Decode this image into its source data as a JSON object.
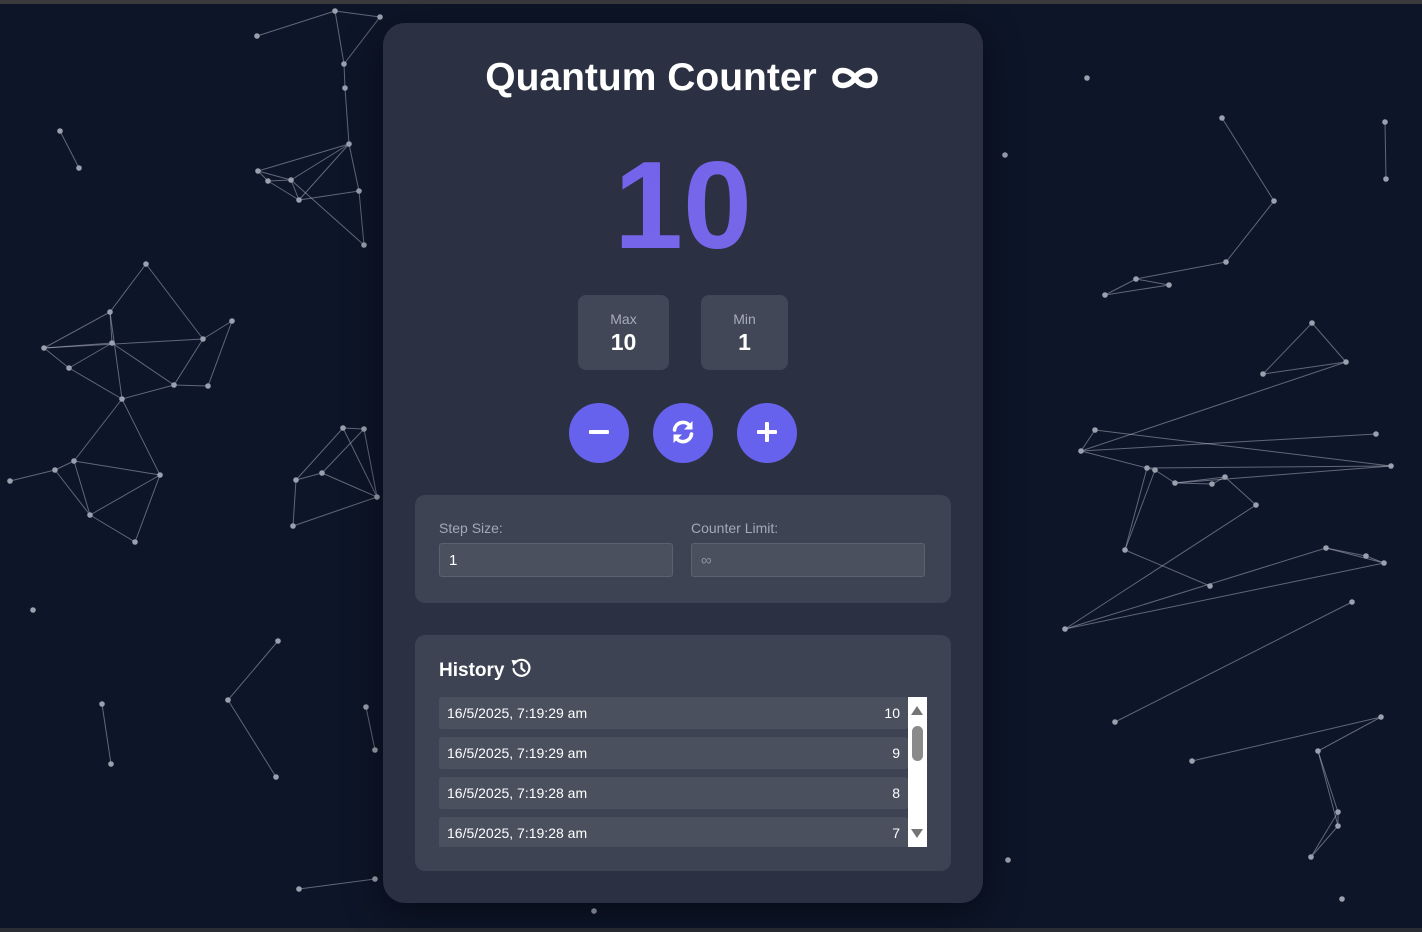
{
  "app": {
    "title": "Quantum Counter",
    "title_icon": "infinity-icon",
    "accent_color": "#6662ee",
    "count_color": "#7264ea"
  },
  "counter": {
    "value": "10"
  },
  "stats": {
    "max_label": "Max",
    "max_value": "10",
    "min_label": "Min",
    "min_value": "1"
  },
  "controls": {
    "decrement_icon": "minus-icon",
    "reset_icon": "refresh-icon",
    "increment_icon": "plus-icon"
  },
  "settings": {
    "step_label": "Step Size:",
    "step_value": "1",
    "limit_label": "Counter Limit:",
    "limit_placeholder": "∞"
  },
  "history": {
    "title": "History",
    "title_icon": "history-icon",
    "entries": [
      {
        "timestamp": "16/5/2025, 7:19:29 am",
        "value": "10"
      },
      {
        "timestamp": "16/5/2025, 7:19:29 am",
        "value": "9"
      },
      {
        "timestamp": "16/5/2025, 7:19:28 am",
        "value": "8"
      },
      {
        "timestamp": "16/5/2025, 7:19:28 am",
        "value": "7"
      }
    ]
  }
}
